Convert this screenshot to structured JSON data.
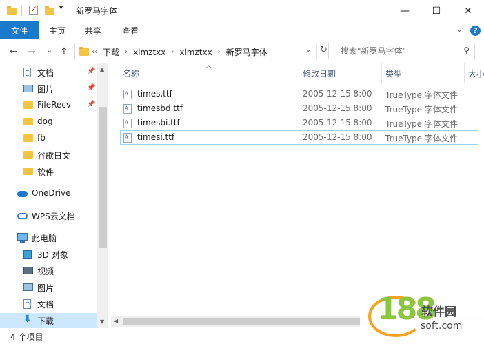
{
  "title": {
    "text": "新罗马字体"
  },
  "window_controls": {
    "minimize": "—",
    "maximize": "☐",
    "close": "✕"
  },
  "ribbon": {
    "file": "文件",
    "home": "主页",
    "share": "共享",
    "view": "查看",
    "help": "?"
  },
  "nav": {
    "back": "←",
    "forward": "→",
    "recent": "⌄",
    "up": "↑"
  },
  "address": {
    "overflow": "‹‹",
    "crumbs": [
      "下载",
      "xlmztxx",
      "xlmztxx",
      "新罗马字体"
    ],
    "separator": "›"
  },
  "search": {
    "placeholder": "搜索\"新罗马字体\"",
    "icon": "search-icon"
  },
  "sidebar": {
    "quick_access": [
      {
        "label": "文档",
        "icon": "document-icon",
        "pinned": true
      },
      {
        "label": "图片",
        "icon": "picture-icon",
        "pinned": true
      },
      {
        "label": "FileRecv",
        "icon": "folder-icon",
        "pinned": true
      },
      {
        "label": "dog",
        "icon": "folder-icon"
      },
      {
        "label": "fb",
        "icon": "folder-icon"
      },
      {
        "label": "谷歌日文",
        "icon": "folder-icon"
      },
      {
        "label": "软件",
        "icon": "folder-icon"
      }
    ],
    "onedrive": "OneDrive",
    "wps": "WPS云文档",
    "this_pc": "此电脑",
    "pc_items": [
      {
        "label": "3D 对象",
        "icon": "3d-objects-icon"
      },
      {
        "label": "视频",
        "icon": "video-icon"
      },
      {
        "label": "图片",
        "icon": "picture-icon"
      },
      {
        "label": "文档",
        "icon": "document-icon"
      },
      {
        "label": "下载",
        "icon": "download-icon",
        "selected": true
      }
    ]
  },
  "columns": {
    "name": "名称",
    "date": "修改日期",
    "type": "类型",
    "size": "大小"
  },
  "files": [
    {
      "name": "times.ttf",
      "date": "2005-12-15 8:00",
      "type": "TrueType 字体文件"
    },
    {
      "name": "timesbd.ttf",
      "date": "2005-12-15 8:00",
      "type": "TrueType 字体文件"
    },
    {
      "name": "timesbi.ttf",
      "date": "2005-12-15 8:00",
      "type": "TrueType 字体文件"
    },
    {
      "name": "timesi.ttf",
      "date": "2005-12-15 8:00",
      "type": "TrueType 字体文件",
      "focused": true
    }
  ],
  "status": {
    "count": "4 个项目"
  },
  "watermark": {
    "number": "188",
    "cn": "软件园",
    "url": "soft.com"
  },
  "colors": {
    "accent": "#1979ca",
    "selection": "#cce8ff",
    "folder": "#f4c443"
  }
}
